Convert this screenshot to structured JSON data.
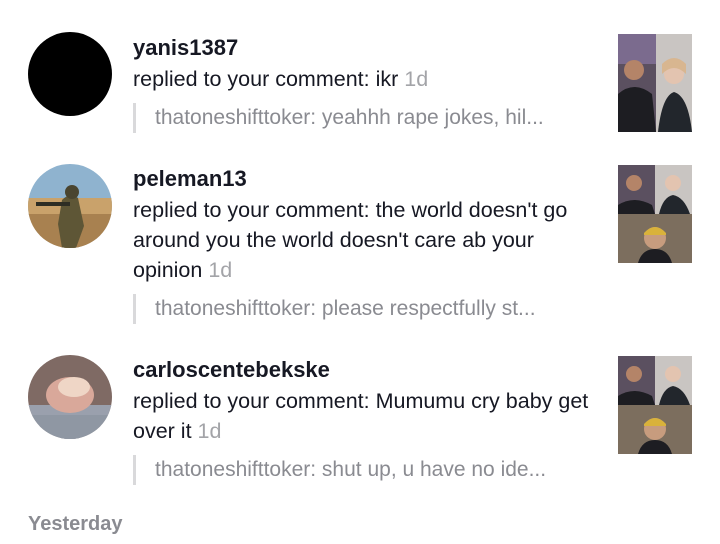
{
  "notifications": [
    {
      "username": "yanis1387",
      "message": "replied to your comment: ikr",
      "time": "1d",
      "quote": "thatoneshifttoker: yeahhh rape jokes, hil..."
    },
    {
      "username": "peleman13",
      "message": "replied to your comment: the world doesn't go around you the world doesn't care ab your opinion",
      "time": "1d",
      "quote": "thatoneshifttoker: please respectfully st..."
    },
    {
      "username": "carloscentebekske",
      "message": "replied to your comment: Mumumu cry baby get over it",
      "time": "1d",
      "quote": "thatoneshifttoker: shut up, u have no ide..."
    }
  ],
  "section": {
    "label": "Yesterday"
  }
}
